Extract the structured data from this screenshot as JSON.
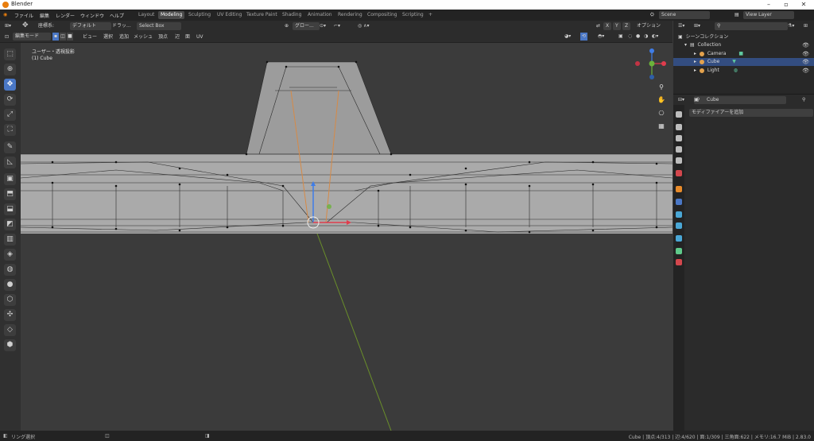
{
  "window": {
    "title": "Blender"
  },
  "menubar": [
    "ファイル",
    "編集",
    "レンダー",
    "ウィンドウ",
    "ヘルプ"
  ],
  "workspaces": [
    "Layout",
    "Modeling",
    "Sculpting",
    "UV Editing",
    "Texture Paint",
    "Shading",
    "Animation",
    "Rendering",
    "Compositing",
    "Scripting"
  ],
  "workspace_add": "+",
  "scene": {
    "name": "Scene",
    "view_layer": "View Layer"
  },
  "header1": {
    "orientation_label": "座標系:",
    "orientation_value": "デフォルト",
    "drag_label": "ドラッ...",
    "drag_value": "Select Box",
    "transform_label": "グロー...",
    "options": "オプション",
    "axes": [
      "X",
      "Y",
      "Z"
    ]
  },
  "header2": {
    "mode": "編集モード",
    "menus": [
      "ビュー",
      "選択",
      "追加",
      "メッシュ",
      "頂点",
      "辺",
      "面",
      "UV"
    ]
  },
  "viewport": {
    "view_name": "ユーザー・透視投影",
    "object_label": "(1) Cube"
  },
  "outliner": {
    "title": "シーンコレクション",
    "items": [
      {
        "name": "Collection",
        "icon": "collection-icon",
        "color": "#c8c8c8",
        "selected": false
      },
      {
        "name": "Camera",
        "icon": "camera-icon",
        "color": "#e4a24d",
        "selected": false
      },
      {
        "name": "Cube",
        "icon": "mesh-icon",
        "color": "#e4a24d",
        "selected": true
      },
      {
        "name": "Light",
        "icon": "light-icon",
        "color": "#e4a24d",
        "selected": false
      }
    ]
  },
  "properties": {
    "object_name": "Cube",
    "add_modifier": "モディファイアーを追加"
  },
  "statusbar": {
    "left": "リング選択",
    "right": "Cube | 頂点:4/313 | 辺:4/620 | 面:1/309 | 三角面:622 | メモリ:16.7 MiB | 2.83.0"
  },
  "colors": {
    "accent": "#4a77c5",
    "selection": "#334d80",
    "axis_x": "#e03c4d",
    "axis_y": "#6bb33a",
    "axis_z": "#3f7de8"
  }
}
